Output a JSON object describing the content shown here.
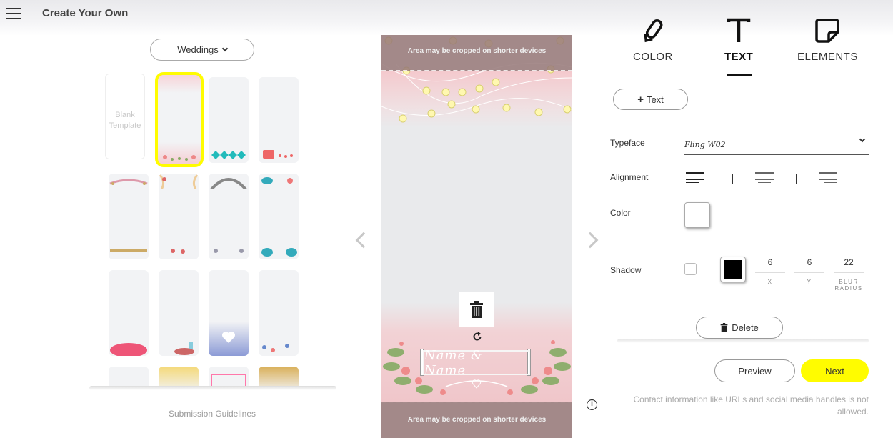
{
  "header": {
    "title": "Create Your Own",
    "menu_icon": "hamburger-icon"
  },
  "category_dropdown": {
    "selected": "Weddings"
  },
  "templates": {
    "blank_label_line1": "Blank",
    "blank_label_line2": "Template",
    "selected_index": 1
  },
  "submission_link": "Submission Guidelines",
  "preview": {
    "crop_notice_top": "Area may be cropped on shorter devices",
    "crop_notice_bottom": "Area may be cropped on shorter devices",
    "text_element": "Name & Name"
  },
  "tabs": [
    {
      "label": "COLOR",
      "icon": "pencil-icon"
    },
    {
      "label": "TEXT",
      "icon": "text-icon",
      "active": true
    },
    {
      "label": "ELEMENTS",
      "icon": "sticker-icon"
    }
  ],
  "text_panel": {
    "add_text_label": "Text",
    "typeface_label": "Typeface",
    "typeface_value": "Fling W02",
    "alignment_label": "Alignment",
    "color_label": "Color",
    "color_value": "#FFFFFF",
    "shadow_label": "Shadow",
    "shadow_color": "#000000",
    "shadow_x": "6",
    "shadow_y": "6",
    "shadow_blur": "22",
    "x_label": "X",
    "y_label": "Y",
    "blur_label_line1": "BLUR",
    "blur_label_line2": "RADIUS",
    "delete_label": "Delete"
  },
  "footer": {
    "preview_label": "Preview",
    "next_label": "Next",
    "contact_note": "Contact information like URLs and social media handles is not allowed."
  },
  "colors": {
    "accent_yellow": "#FFFC00",
    "crop_band": "#967878"
  }
}
